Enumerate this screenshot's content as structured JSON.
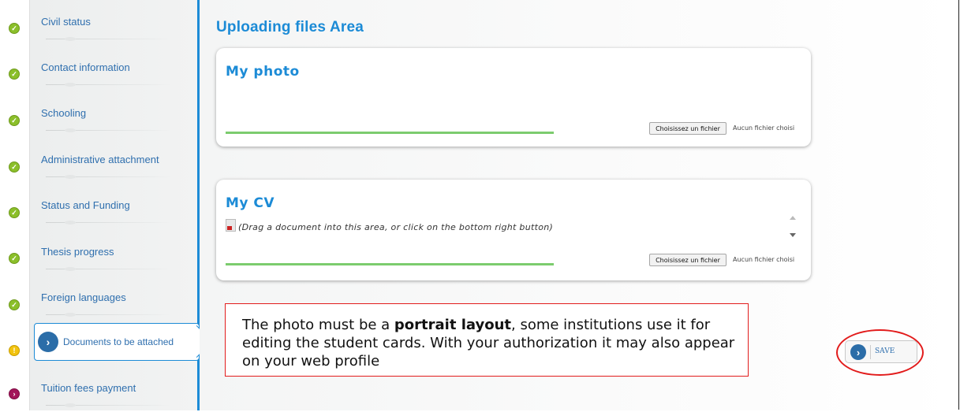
{
  "sidebar": {
    "items": [
      {
        "label": "Civil status",
        "status": "complete"
      },
      {
        "label": "Contact information",
        "status": "complete"
      },
      {
        "label": "Schooling",
        "status": "complete"
      },
      {
        "label": "Administrative attachment",
        "status": "complete"
      },
      {
        "label": "Status and Funding",
        "status": "complete"
      },
      {
        "label": "Thesis progress",
        "status": "complete"
      },
      {
        "label": "Foreign languages",
        "status": "complete"
      },
      {
        "label": "Documents to be attached",
        "status": "warning",
        "active": true
      },
      {
        "label": "Tuition fees payment",
        "status": "pending"
      }
    ]
  },
  "main": {
    "title": "Uploading files Area",
    "photo_panel": {
      "title": "My photo",
      "file_button": "Choisissez un fichier",
      "file_status": "Aucun fichier choisi"
    },
    "cv_panel": {
      "title": "My CV",
      "hint": "(Drag a document into this area, or click on the bottom right button)",
      "file_button": "Choisissez un fichier",
      "file_status": "Aucun fichier choisi"
    }
  },
  "annotation": {
    "text_before": "The photo must be a ",
    "text_bold": "portrait layout",
    "text_after": ", some institutions use it for editing the student cards. With your authorization it may also appear on your web profile"
  },
  "save_button": {
    "label": "SAVE"
  },
  "colors": {
    "accent_blue": "#1c8bd6",
    "complete_green": "#8bbf2a",
    "warning_yellow": "#f2c30f",
    "pending_purple": "#a3155a",
    "highlight_red": "#e21c1c",
    "progress_green": "#7ccc6e"
  },
  "icons": {
    "complete": "check-circle-icon",
    "warning": "exclamation-circle-icon",
    "pending": "chevron-circle-icon",
    "document": "document-icon",
    "save": "chevron-right-icon"
  }
}
